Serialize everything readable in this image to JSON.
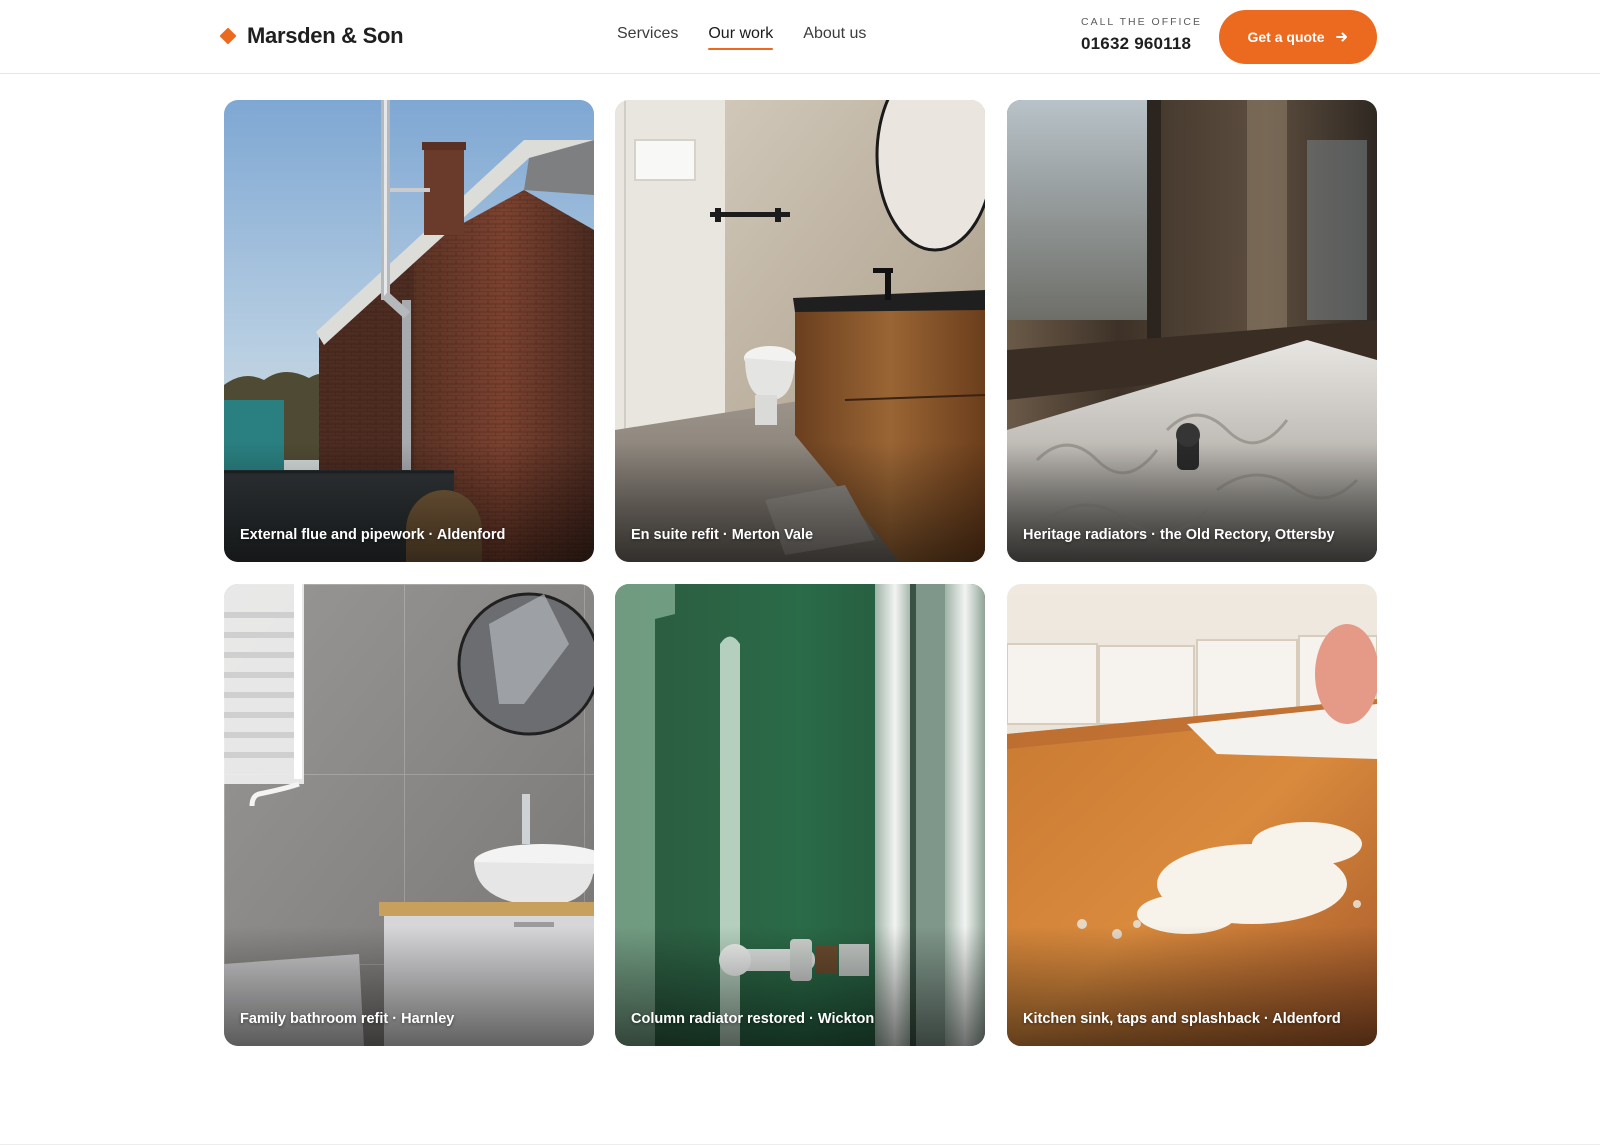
{
  "brand": {
    "name": "Marsden & Son",
    "logo_icon": "diamond-icon",
    "accent": "#ec6a1f"
  },
  "nav": {
    "items": [
      {
        "label": "Services",
        "active": false
      },
      {
        "label": "Our work",
        "active": true
      },
      {
        "label": "About us",
        "active": false
      }
    ]
  },
  "contact": {
    "label": "CALL THE OFFICE",
    "phone": "01632 960118"
  },
  "cta": {
    "label": "Get a quote",
    "icon": "arrow-right-icon"
  },
  "gallery": {
    "items": [
      {
        "caption": "External flue and pipework · Aldenford",
        "image": "brick-house-flue-photo"
      },
      {
        "caption": "En suite refit · Merton Vale",
        "image": "ensuite-bathroom-photo"
      },
      {
        "caption": "Heritage radiators · the Old Rectory, Ottersby",
        "image": "ornate-radiator-photo"
      },
      {
        "caption": "Family bathroom refit · Harnley",
        "image": "grey-tiled-bathroom-photo"
      },
      {
        "caption": "Column radiator restored · Wickton",
        "image": "green-wall-radiator-photo"
      },
      {
        "caption": "Kitchen sink, taps and splashback · Aldenford",
        "image": "kitchen-worktop-photo"
      }
    ]
  }
}
